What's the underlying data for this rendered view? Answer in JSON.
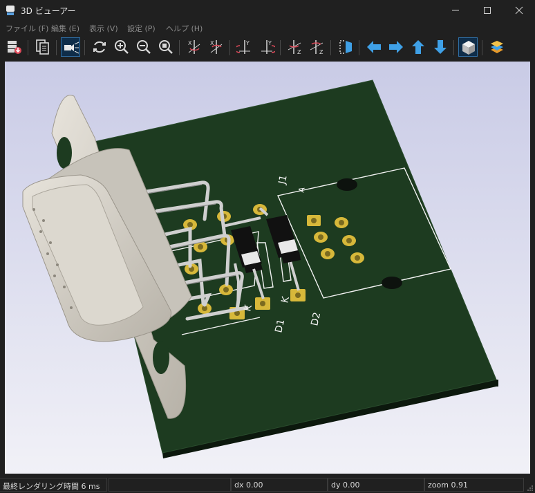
{
  "window": {
    "title": "3D ビューアー"
  },
  "menu": [
    "ファイル (F)",
    "編集 (E)",
    "表示 (V)",
    "設定 (P)",
    "ヘルプ (H)"
  ],
  "toolbar": {
    "buttons": [
      "reload-board-icon",
      "copy-image-icon",
      "raytracing-icon",
      "refresh-icon",
      "zoom-in-icon",
      "zoom-out-icon",
      "zoom-fit-icon",
      "rotate-x-cw-icon",
      "rotate-x-ccw-icon",
      "rotate-y-cw-icon",
      "rotate-y-ccw-icon",
      "rotate-z-cw-icon",
      "rotate-z-ccw-icon",
      "flip-view-icon",
      "move-left-icon",
      "move-right-icon",
      "move-up-icon",
      "move-down-icon",
      "ortho-view-icon",
      "layers-icon"
    ]
  },
  "board": {
    "silkscreen": [
      "J1",
      "D1",
      "D2",
      "K",
      "K",
      "A"
    ]
  },
  "status": {
    "render_time": "最終レンダリング時間 6 ms",
    "dx": "dx 0.00",
    "dy": "dy 0.00",
    "zoom": "zoom 0.91"
  },
  "colors": {
    "pcb": "#1d3b20",
    "silkscreen": "#f2f2f2",
    "copper_pad": "#d7b83a",
    "accent_blue": "#3fa0e6"
  }
}
